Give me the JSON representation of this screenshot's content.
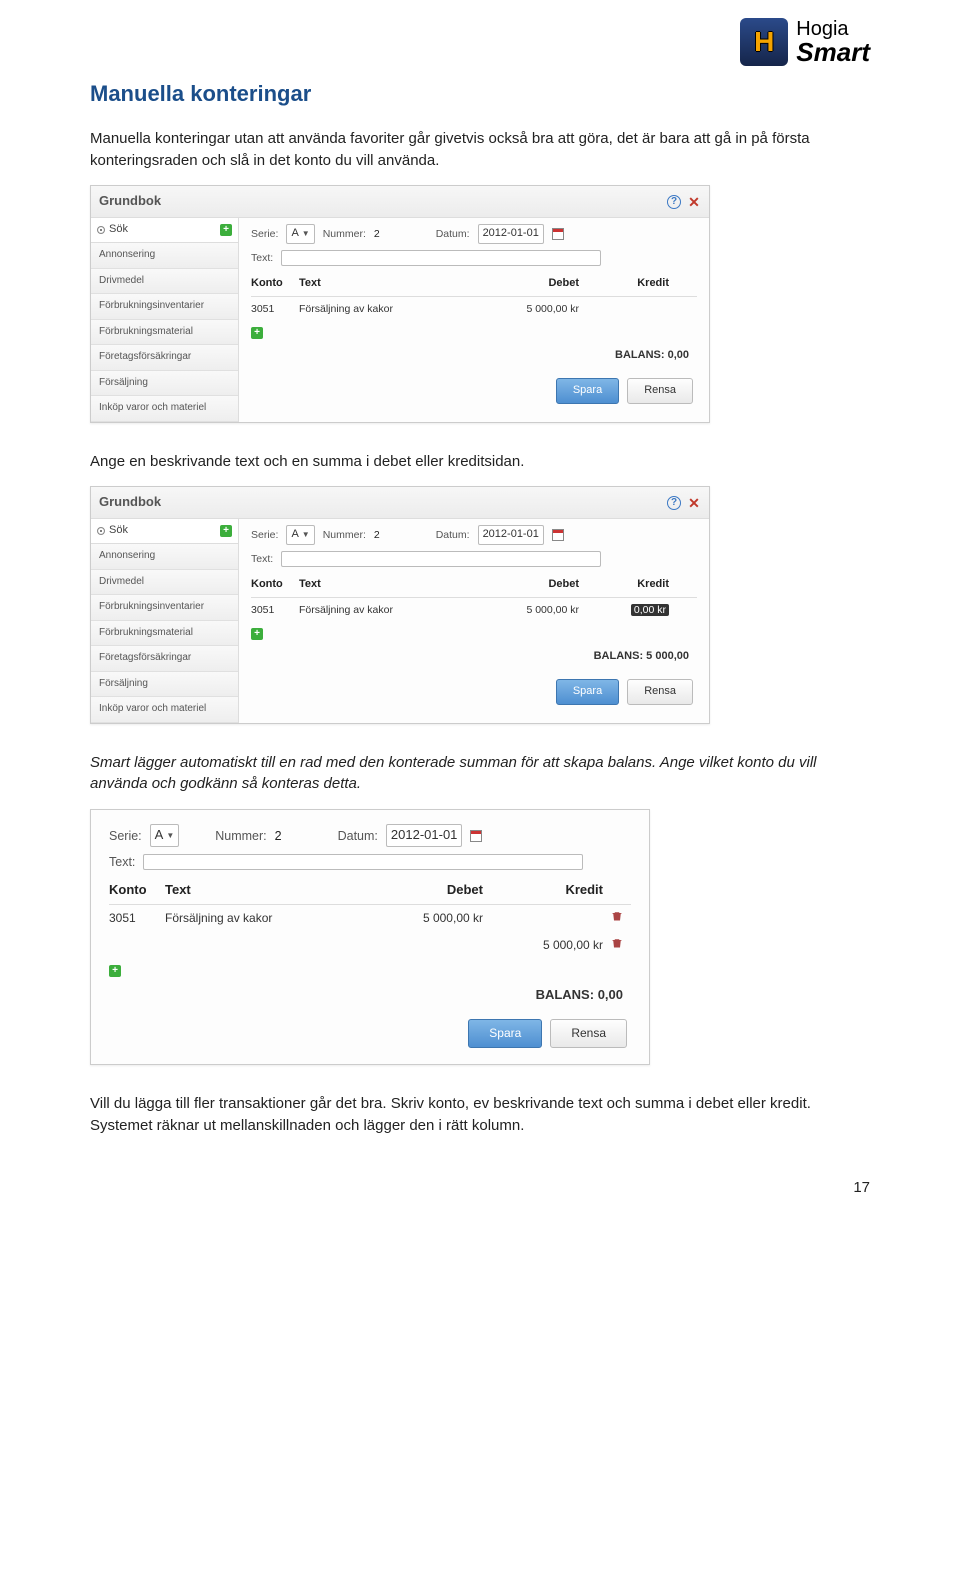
{
  "brand": {
    "name1": "Hogia",
    "name2": "Smart",
    "badge": "H"
  },
  "section_title": "Manuella konteringar",
  "para1": "Manuella konteringar utan att använda favoriter går givetvis också bra att göra, det är bara att gå in på första konteringsraden och slå in det konto du vill använda.",
  "para2": "Ange en beskrivande text och en summa i debet eller kreditsidan.",
  "para3": "Smart lägger automatiskt till en rad med den konterade summan för att skapa balans. Ange vilket konto du vill använda och godkänn så konteras detta.",
  "para4": "Vill du lägga till fler transaktioner går det bra. Skriv konto, ev beskrivande text och summa i debet eller kredit. Systemet räknar ut mellanskillnaden och lägger den i rätt kolumn.",
  "page_number": "17",
  "labels": {
    "grundbok": "Grundbok",
    "sok": "Sök",
    "serie": "Serie:",
    "nummer": "Nummer:",
    "datum": "Datum:",
    "text": "Text:",
    "konto": "Konto",
    "texth": "Text",
    "debet": "Debet",
    "kredit": "Kredit",
    "balans": "BALANS:",
    "spara": "Spara",
    "rensa": "Rensa"
  },
  "sidebar_items": [
    "Annonsering",
    "Drivmedel",
    "Förbrukningsinventarier",
    "Förbrukningsmaterial",
    "Företagsförsäkringar",
    "Försäljning",
    "Inköp varor och materiel"
  ],
  "shot_common": {
    "serie_val": "A",
    "nummer_val": "2",
    "datum_val": "2012-01-01",
    "konto_val": "3051",
    "text_val": "Försäljning av kakor",
    "deb_val": "5 000,00 kr"
  },
  "shot1": {
    "balans_val": "0,00"
  },
  "shot2": {
    "kredit_val": "0,00 kr",
    "balans_val": "5 000,00"
  },
  "shot3": {
    "rows": [
      {
        "konto": "3051",
        "text": "Försäljning av kakor",
        "debet": "5 000,00 kr",
        "kredit": ""
      },
      {
        "konto": "",
        "text": "",
        "debet": "",
        "kredit": "5 000,00 kr"
      }
    ],
    "balans_val": "0,00"
  }
}
